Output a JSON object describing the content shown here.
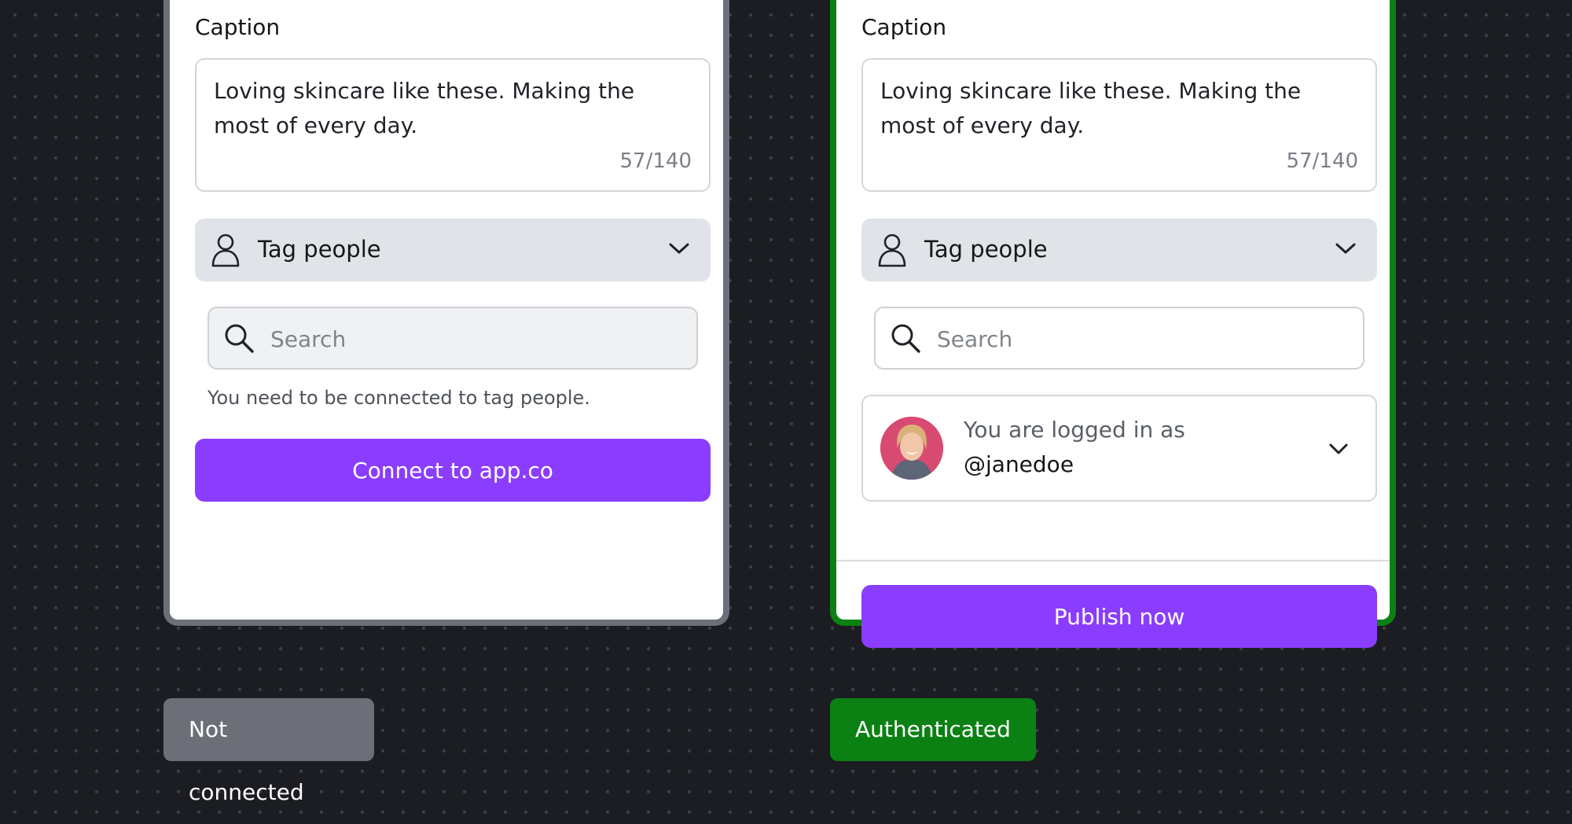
{
  "left_panel": {
    "caption_label": "Caption",
    "caption_text": "Loving skincare like these. Making the most of every day.",
    "caption_count": "57/140",
    "tag_label": "Tag people",
    "search_placeholder": "Search",
    "helper_text": "You need to be connected to tag people.",
    "connect_label": "Connect to app.co",
    "status": "Not connected"
  },
  "right_panel": {
    "caption_label": "Caption",
    "caption_text": "Loving skincare like these. Making the most of every day.",
    "caption_count": "57/140",
    "tag_label": "Tag people",
    "search_placeholder": "Search",
    "logged_in_label": "You are logged in as",
    "username": "@janedoe",
    "publish_label": "Publish now",
    "status": "Authenticated"
  },
  "icons": {
    "person": "person-icon",
    "search": "search-icon",
    "chevron": "chevron-down-icon"
  },
  "colors": {
    "accent": "#8b3dff",
    "not_connected": "#6c6f78",
    "authenticated": "#0b8113",
    "background": "#1b1d22"
  }
}
